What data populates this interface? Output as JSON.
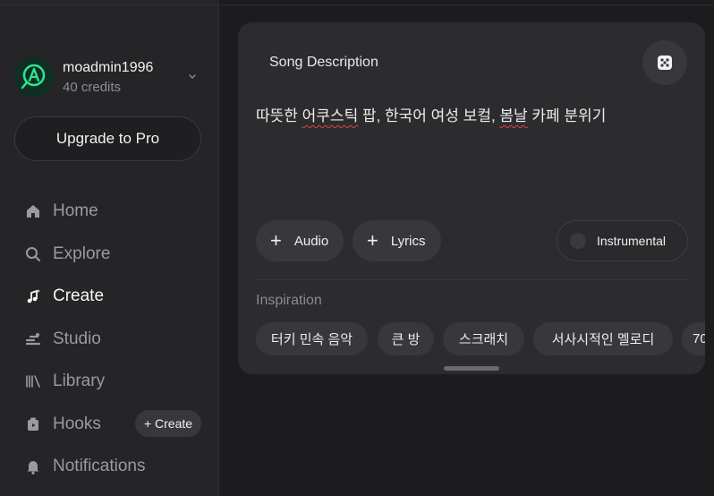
{
  "sidebar": {
    "profile": {
      "username": "moadmin1996",
      "credits": "40 credits"
    },
    "upgrade_label": "Upgrade to Pro",
    "items": [
      {
        "label": "Home",
        "icon": "home-icon",
        "active": false
      },
      {
        "label": "Explore",
        "icon": "search-icon",
        "active": false
      },
      {
        "label": "Create",
        "icon": "music-sparkle-icon",
        "active": true
      },
      {
        "label": "Studio",
        "icon": "studio-icon",
        "active": false
      },
      {
        "label": "Library",
        "icon": "library-icon",
        "active": false
      },
      {
        "label": "Hooks",
        "icon": "hooks-icon",
        "active": false
      },
      {
        "label": "Notifications",
        "icon": "bell-icon",
        "active": false
      }
    ],
    "hooks_create_label": "+ Create"
  },
  "editor": {
    "title": "Song Description",
    "prompt": {
      "parts": [
        "따뜻한 ",
        "어쿠스틱",
        " 팝, 한국어 여성 보컬, ",
        "봄날",
        " 카페 분위기"
      ]
    },
    "buttons": {
      "audio": "Audio",
      "lyrics": "Lyrics",
      "instrumental": "Instrumental"
    },
    "inspiration_label": "Inspiration",
    "inspiration_chips": [
      "터키 민속 음악",
      "큰 방",
      "스크래치",
      "서사시적인 멜로디",
      "70"
    ]
  },
  "colors": {
    "background": "#1c1c1e",
    "sidebar": "#252527",
    "card": "#2c2c2f",
    "chip": "#38383c",
    "accent": "#2ee58e",
    "spellcheck": "#e0443e"
  }
}
